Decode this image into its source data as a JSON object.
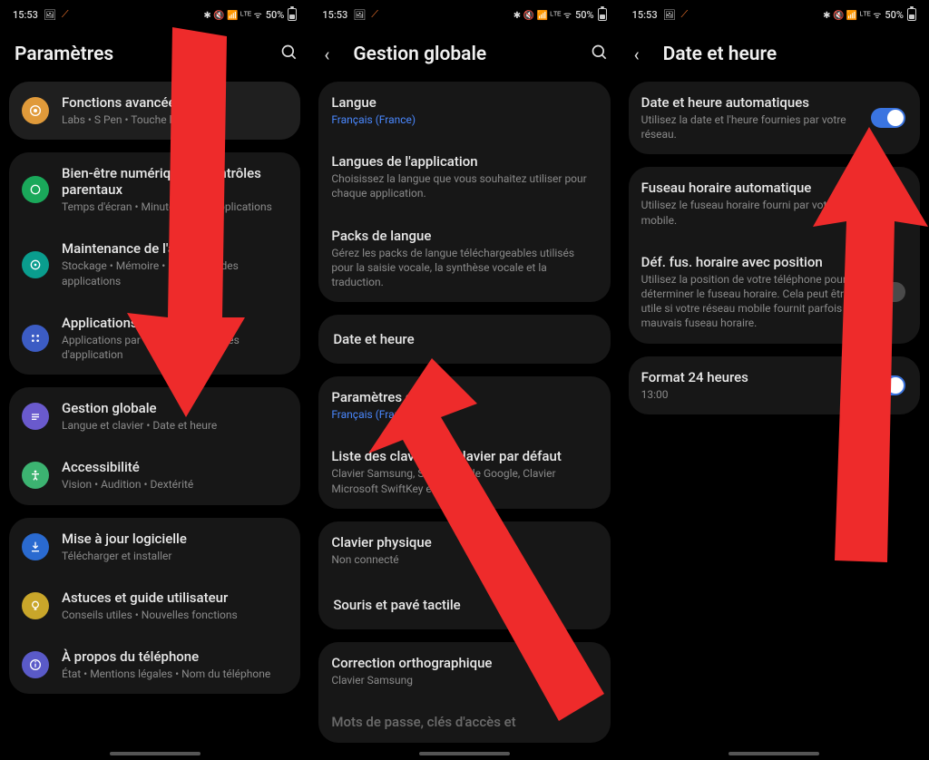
{
  "status": {
    "time": "15:53",
    "battery": "50%",
    "icons": "✴ 🔇 📶 VoLTE ᯤ"
  },
  "screen1": {
    "title": "Paramètres",
    "group1": [
      {
        "title": "Fonctions avancées",
        "sub": "Labs  •  S Pen  •  Touche lat..."
      }
    ],
    "group2": [
      {
        "title": "Bien-être numérique et contrôles parentaux",
        "sub": "Temps d'écran  •  Minuteurs des applications"
      },
      {
        "title": "Maintenance de l'appareil",
        "sub": "Stockage  •  Mémoire  •  Protection des applications"
      },
      {
        "title": "Applications",
        "sub": "Applications par défaut  •  Paramètres d'application"
      }
    ],
    "group3": [
      {
        "title": "Gestion globale",
        "sub": "Langue et clavier  •  Date et heure"
      },
      {
        "title": "Accessibilité",
        "sub": "Vision  •  Audition  •  Dextérité"
      }
    ],
    "group4": [
      {
        "title": "Mise à jour logicielle",
        "sub": "Télécharger et installer"
      },
      {
        "title": "Astuces et guide utilisateur",
        "sub": "Conseils utiles  •  Nouvelles fonctions"
      },
      {
        "title": "À propos du téléphone",
        "sub": "État  •  Mentions légales  •  Nom du téléphone"
      }
    ]
  },
  "screen2": {
    "title": "Gestion globale",
    "group1": [
      {
        "title": "Langue",
        "sub": "Français (France)",
        "link": true
      },
      {
        "title": "Langues de l'application",
        "sub": "Choisissez la langue que vous souhaitez utiliser pour chaque application."
      },
      {
        "title": "Packs de langue",
        "sub": "Gérez les packs de langue téléchargeables utilisés pour la saisie vocale, la synthèse vocale et la traduction."
      }
    ],
    "group2": [
      {
        "title": "Date et heure",
        "sub": ""
      }
    ],
    "group3": [
      {
        "title": "Paramètres clavier",
        "sub": "Français (France)",
        "link": true
      },
      {
        "title": "Liste des claviers et clavier par défaut",
        "sub": "Clavier Samsung, Saisie vocale Google, Clavier Microsoft SwiftKey et Gboard"
      }
    ],
    "group4": [
      {
        "title": "Clavier physique",
        "sub": "Non connecté"
      },
      {
        "title": "Souris et pavé tactile",
        "sub": ""
      }
    ],
    "group5": [
      {
        "title": "Correction orthographique",
        "sub": "Clavier Samsung"
      },
      {
        "title": "Mots de passe, clés d'accès et",
        "sub": ""
      }
    ]
  },
  "screen3": {
    "title": "Date et heure",
    "group1": [
      {
        "title": "Date et heure automatiques",
        "sub": "Utilisez la date et l'heure fournies par votre réseau.",
        "toggle": true
      }
    ],
    "group2": [
      {
        "title": "Fuseau horaire automatique",
        "sub": "Utilisez le fuseau horaire fourni par votre réseau mobile."
      },
      {
        "title": "Déf. fus. horaire avec position",
        "sub": "Utilisez la position de votre téléphone pour déterminer le fuseau horaire. Cela peut être utile si votre réseau mobile fournit parfois un mauvais fuseau horaire.",
        "toggle": false
      }
    ],
    "group3": [
      {
        "title": "Format 24 heures",
        "sub": "13:00",
        "toggle": true
      }
    ]
  }
}
